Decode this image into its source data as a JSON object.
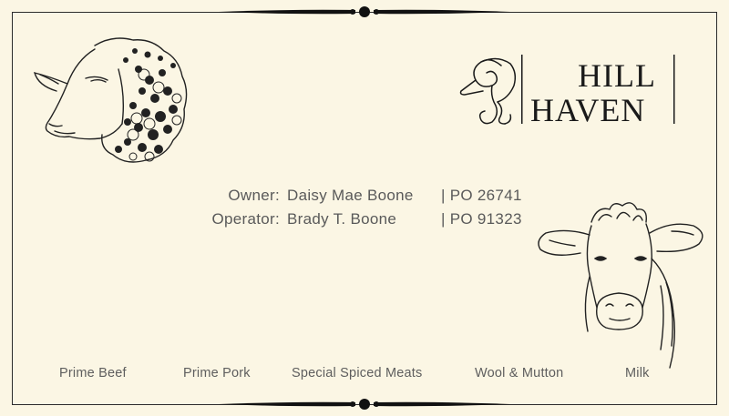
{
  "brand": {
    "name_line1": "HILL",
    "name_line2": "HAVEN",
    "logo_icon": "ram-head-icon"
  },
  "illustrations": {
    "left": "sheep-head-icon",
    "right": "calf-head-icon"
  },
  "contacts": [
    {
      "role": "Owner:",
      "name": "Daisy Mae Boone",
      "po": "| PO 26741"
    },
    {
      "role": "Operator:",
      "name": "Brady T. Boone",
      "po": "| PO 91323"
    }
  ],
  "products": [
    "Prime Beef",
    "Prime Pork",
    "Special Spiced Meats",
    "Wool & Mutton",
    "Milk"
  ],
  "colors": {
    "background": "#fbf6e4",
    "ink": "#1a1a1a",
    "text": "#5a5a5a"
  }
}
